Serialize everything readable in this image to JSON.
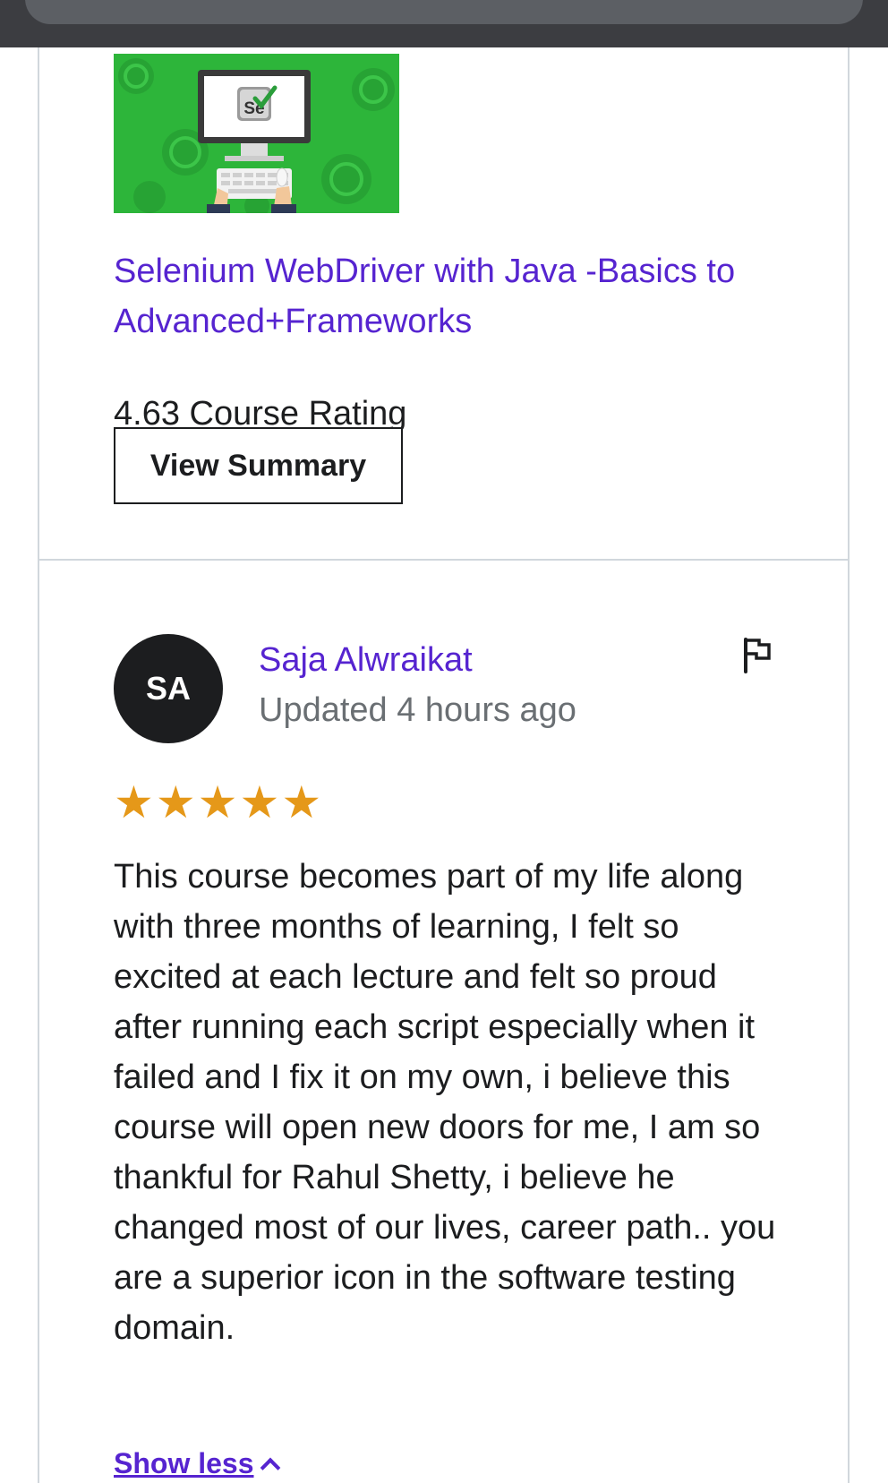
{
  "course": {
    "title": "Selenium WebDriver with Java -Basics to Advanced+Frameworks",
    "rating_text": "4.63 Course Rating",
    "view_summary_label": "View Summary",
    "thumbnail_logo_text": "Se"
  },
  "review": {
    "avatar_initials": "SA",
    "reviewer_name": "Saja Alwraikat",
    "updated": "Updated 4 hours ago",
    "rating": 5,
    "rating_max": 5,
    "text": "This course becomes part of my life along with three months of learning, I felt so excited at each lecture and felt so proud after running each script especially when it failed and I fix it on my own, i believe this course will open new doors for me, I am so thankful for Rahul Shetty, i believe he changed most of our lives, career path.. you are a superior icon in the software testing domain.",
    "show_less_label": "Show less"
  },
  "icons": {
    "flag": "flag-icon",
    "star": "star-icon",
    "chevron": "chevron-up-icon"
  },
  "colors": {
    "link_purple": "#5624d0",
    "star_orange": "#e59819",
    "thumbnail_green": "#2db53a"
  }
}
